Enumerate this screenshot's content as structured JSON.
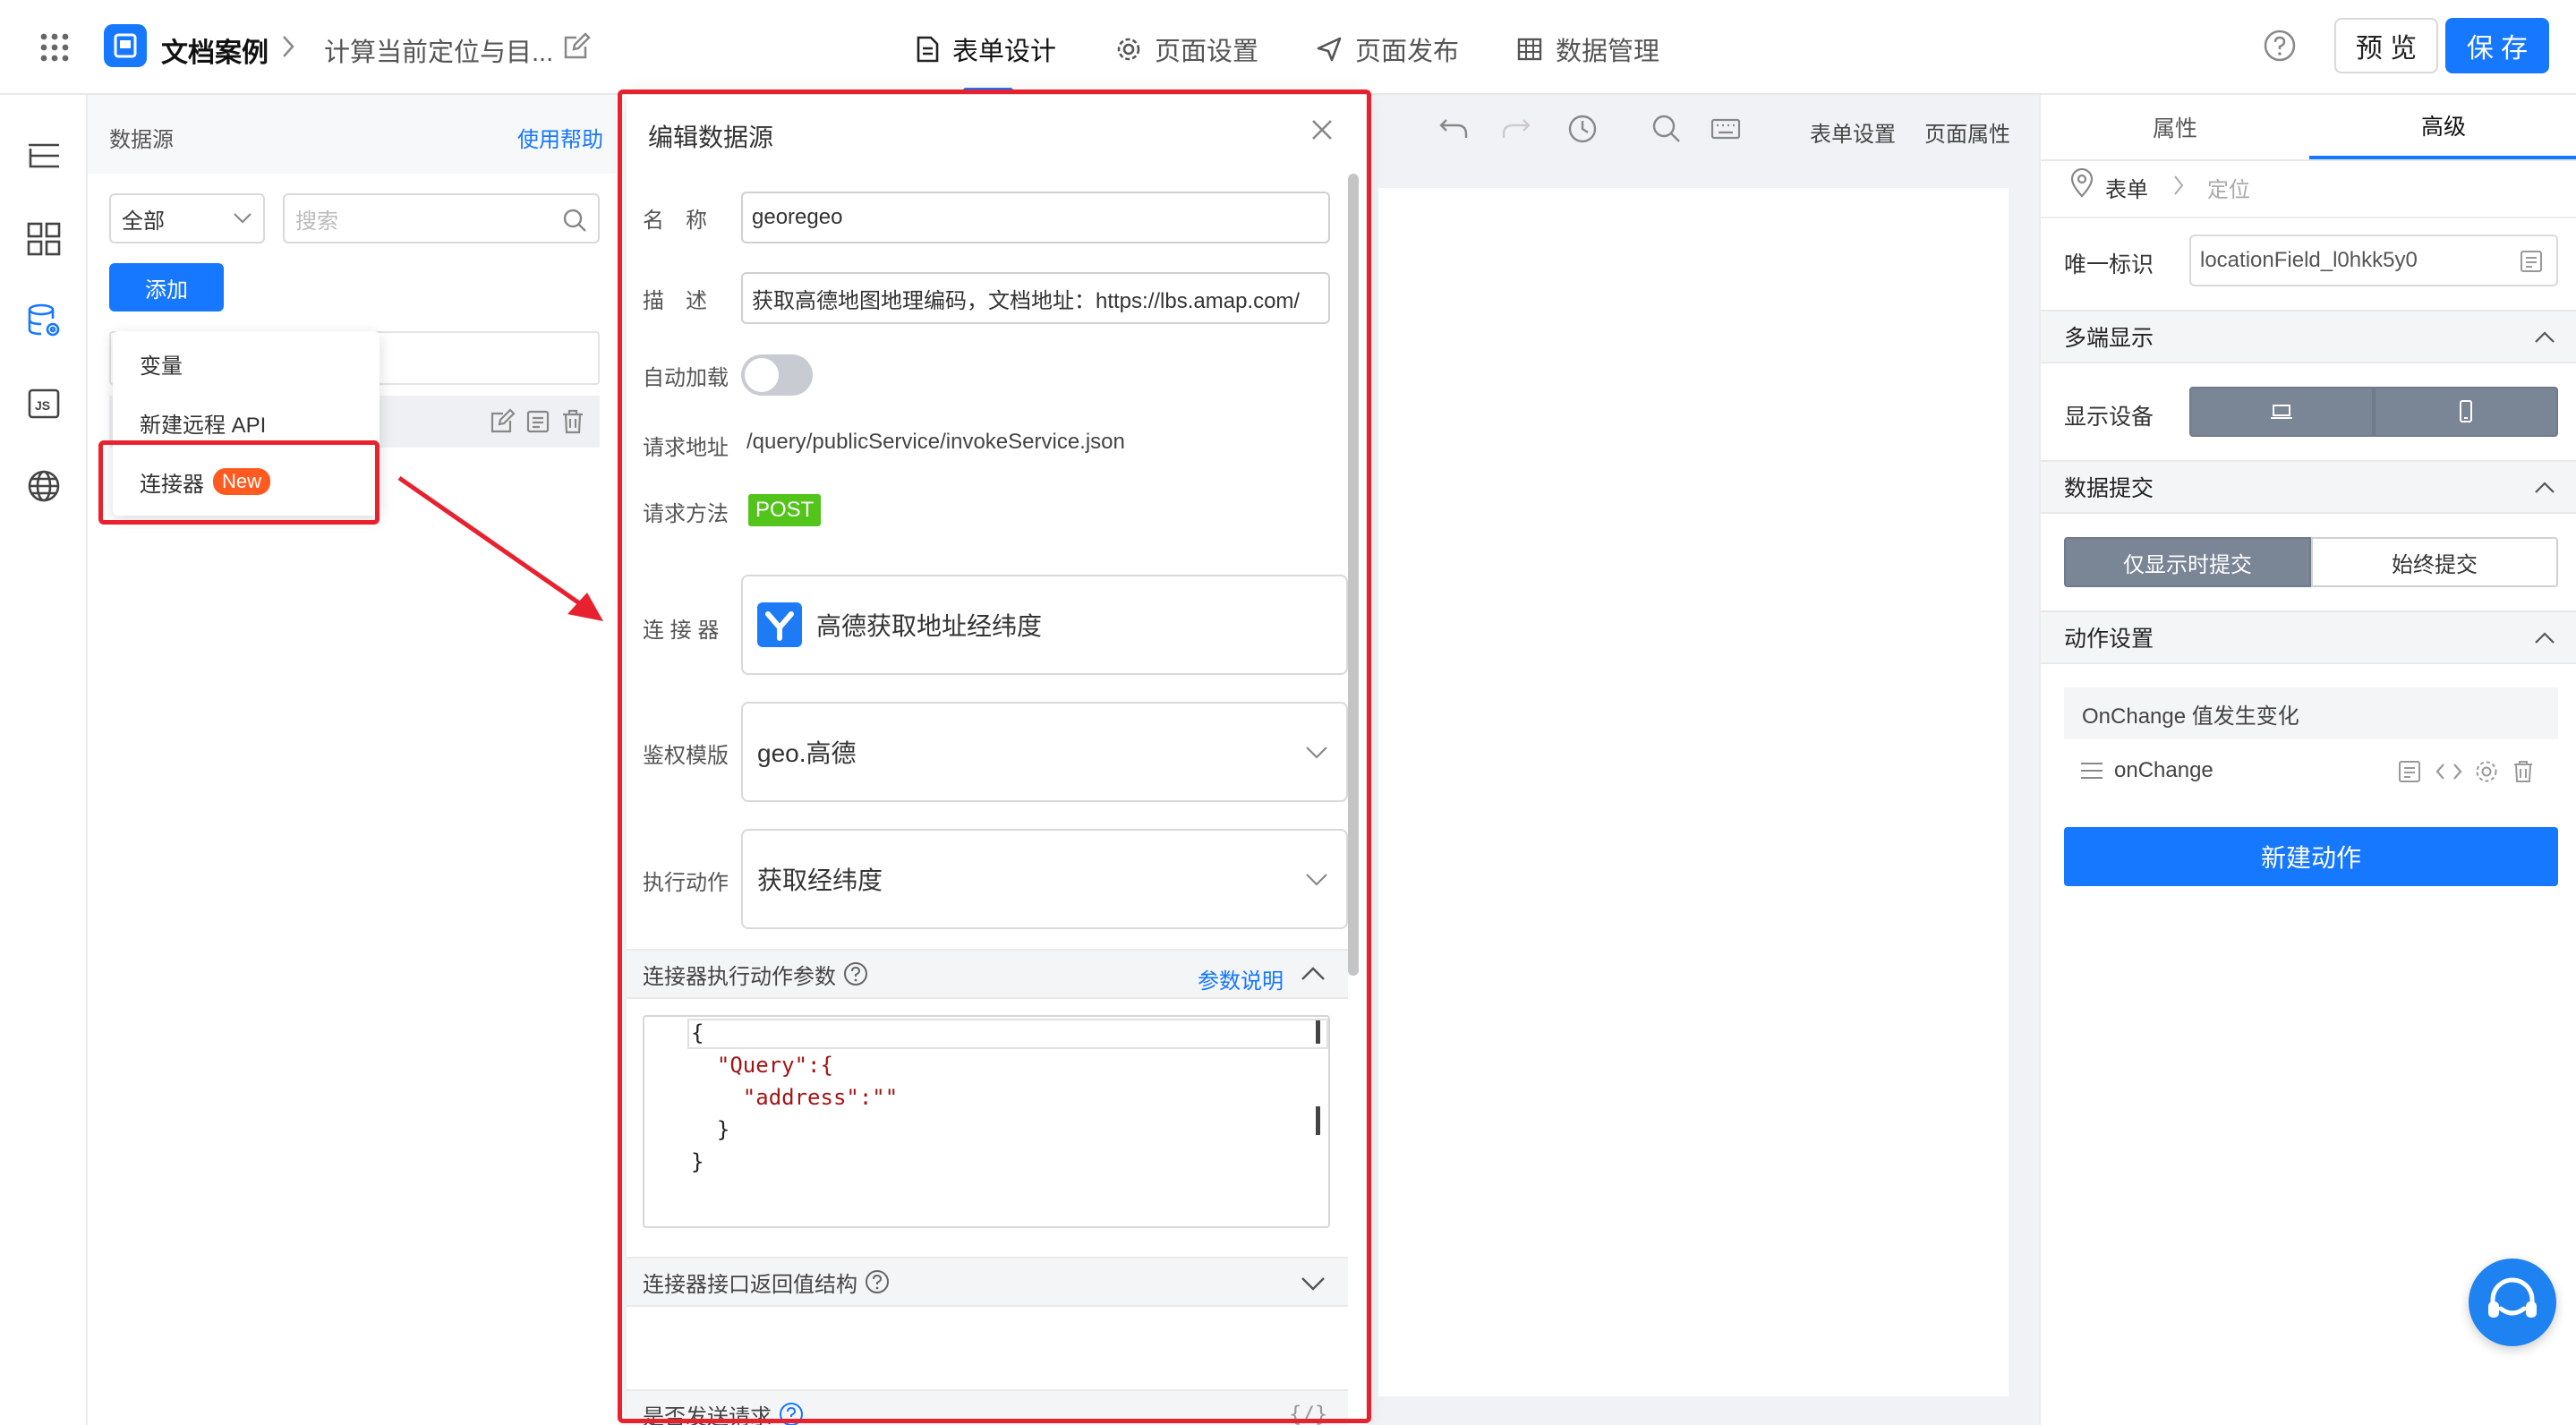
{
  "topbar": {
    "app_title": "文档案例",
    "page_title": "计算当前定位与目...",
    "tabs": [
      {
        "label": "表单设计"
      },
      {
        "label": "页面设置"
      },
      {
        "label": "页面发布"
      },
      {
        "label": "数据管理"
      }
    ],
    "help_icon": "question-circle-icon",
    "preview_label": "预 览",
    "save_label": "保 存",
    "accent": "#1677ff"
  },
  "datasource": {
    "title": "数据源",
    "help_link": "使用帮助",
    "filter_value": "全部",
    "search_placeholder": "搜索",
    "add_label": "添加",
    "menu": [
      {
        "label": "变量"
      },
      {
        "label": "新建远程 API"
      },
      {
        "label": "连接器",
        "badge": "New"
      }
    ]
  },
  "toolbar": {
    "form_settings": "表单设置",
    "page_props": "页面属性"
  },
  "dialog": {
    "title": "编辑数据源",
    "fields": {
      "name_label": "名　称",
      "name_value": "georegeo",
      "desc_label": "描　述",
      "desc_value": "获取高德地图地理编码，文档地址：https://lbs.amap.com/",
      "autoload_label": "自动加载",
      "url_label": "请求地址",
      "url_value": "/query/publicService/invokeService.json",
      "method_label": "请求方法",
      "method_value": "POST",
      "connector_label": "连 接 器",
      "connector_value": "高德获取地址经纬度",
      "auth_label": "鉴权模版",
      "auth_value": "geo.高德",
      "action_label": "执行动作",
      "action_value": "获取经纬度"
    },
    "params_section": "连接器执行动作参数",
    "params_help": "参数说明",
    "code_lines": [
      "{",
      "  \"Query\":{",
      "    \"address\":\"\"",
      "  }",
      "}"
    ],
    "return_section": "连接器接口返回值结构",
    "send_section": "是否发送请求",
    "send_icon_text": "{/}",
    "method_color": "#52c41a"
  },
  "rightpanel": {
    "tabs": [
      {
        "label": "属性"
      },
      {
        "label": "高级"
      }
    ],
    "breadcrumb": [
      "表单",
      "定位"
    ],
    "id_label": "唯一标识",
    "id_value": "locationField_l0hkk5y0",
    "multi_section": "多端显示",
    "device_label": "显示设备",
    "submit_section": "数据提交",
    "submit_options": [
      "仅显示时提交",
      "始终提交"
    ],
    "action_section": "动作设置",
    "onchange_title": "OnChange 值发生变化",
    "onchange_item": "onChange",
    "new_action_label": "新建动作"
  }
}
